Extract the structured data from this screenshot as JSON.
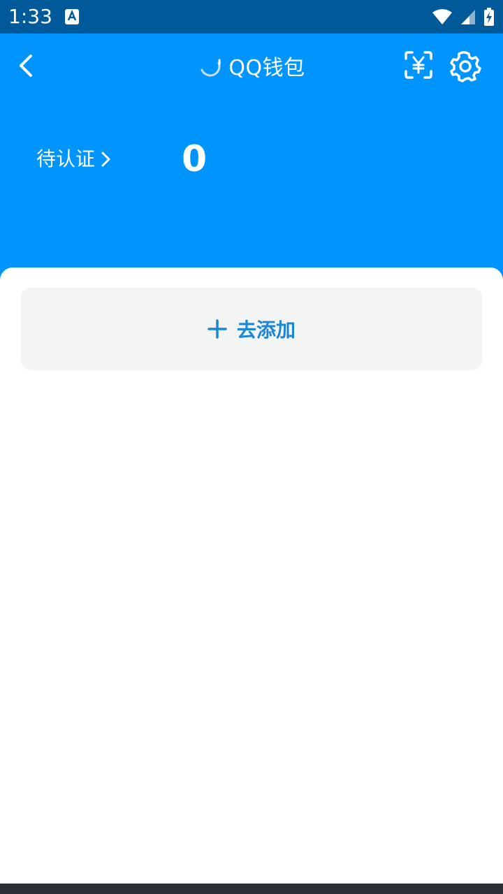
{
  "status_bar": {
    "time": "1:33",
    "notification_icon": "accessibility-a-icon",
    "wifi_icon": "wifi-icon",
    "signal_icon": "signal-icon",
    "battery_icon": "battery-charging-icon",
    "background": "#005A9A"
  },
  "header": {
    "title": "QQ钱包",
    "back_icon": "back-arrow-icon",
    "loading_icon": "loading-spinner-icon",
    "scan_icon": "scan-yen-icon",
    "settings_icon": "gear-icon",
    "background": "#0094FF"
  },
  "balance": {
    "pending_label": "待认证",
    "pending_arrow_icon": "chevron-right-icon",
    "amount": "0"
  },
  "add_card": {
    "label": "去添加",
    "plus_icon": "plus-icon",
    "accent": "#1C86D6"
  }
}
